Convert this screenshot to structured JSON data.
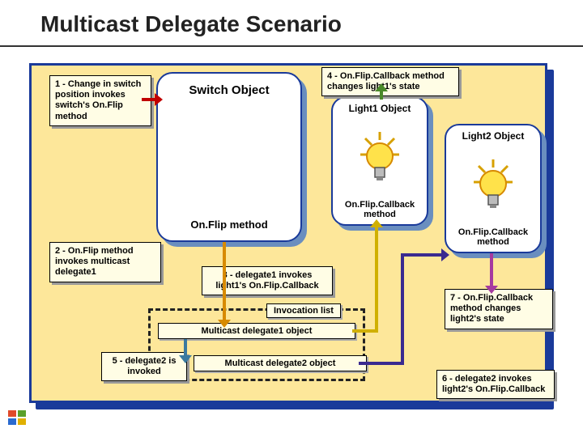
{
  "title": "Multicast Delegate Scenario",
  "switch": {
    "title": "Switch Object",
    "method": "On.Flip method"
  },
  "light1": {
    "title": "Light1 Object",
    "method": "On.Flip.Callback method"
  },
  "light2": {
    "title": "Light2 Object",
    "method": "On.Flip.Callback method"
  },
  "callouts": {
    "c1": "1 - Change in switch position invokes switch's On.Flip method",
    "c2": "2 - On.Flip method invokes multicast delegate1",
    "c3": "3 - delegate1 invokes light1's On.Flip.Callback",
    "c4": "4 - On.Flip.Callback method changes light1's state",
    "c5": "5 - delegate2 is invoked",
    "c6": "6 - delegate2 invokes light2's On.Flip.Callback",
    "c7": "7 - On.Flip.Callback method changes light2's state"
  },
  "invocation": {
    "label": "Invocation list",
    "d1": "Multicast delegate1 object",
    "d2": "Multicast delegate2 object"
  },
  "colors": {
    "c1": "#c00000",
    "c2": "#d78a00",
    "c3": "#d0b000",
    "c4": "#4a8a2a",
    "c5": "#3a7aa0",
    "c6": "#3a2a90",
    "c7": "#a63aa0"
  }
}
